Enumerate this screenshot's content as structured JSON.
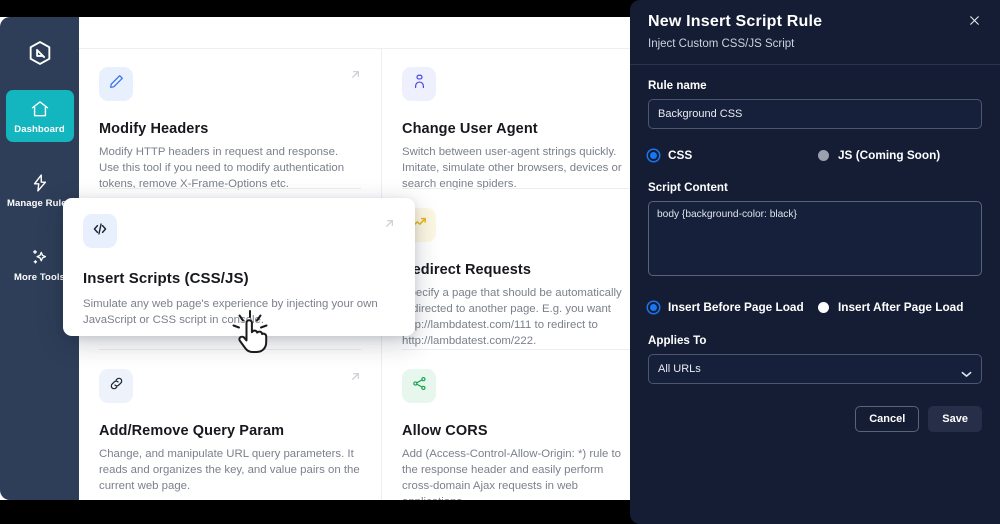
{
  "sidebar": {
    "logo_icon": "cube-logo-icon",
    "items": [
      {
        "label": "Dashboard",
        "icon": "home-icon",
        "active": true
      },
      {
        "label": "Manage Rules",
        "icon": "bolt-icon",
        "active": false
      },
      {
        "label": "More Tools",
        "icon": "sparkles-icon",
        "active": false
      }
    ]
  },
  "cards": [
    {
      "title": "Modify Headers",
      "desc": "Modify HTTP headers in request and response. Use this tool if you need to modify authentication tokens, remove X-Frame-Options etc.",
      "icon": "pencil-icon",
      "icon_color": "#2f6df0",
      "icon_bg": "#e8f0fe"
    },
    {
      "title": "Change User Agent",
      "desc": "Switch between user-agent strings quickly. Imitate, simulate other browsers, devices or search engine spiders.",
      "icon": "users-icon",
      "icon_color": "#4f46e5",
      "icon_bg": "#eef0fe"
    },
    {
      "title": "Redirect Requests",
      "desc": "Specify a page that should be automatically redirected to another page. E.g. you want http://lambdatest.com/111 to redirect to http://lambdatest.com/222.",
      "icon": "redirect-arrow-icon",
      "icon_color": "#eab308",
      "icon_bg": "#fdf8e3"
    },
    {
      "title": "Add/Remove Query Param",
      "desc": "Change, and manipulate URL query parameters. It reads and organizes the key, and value pairs on the current web page.",
      "icon": "link-icon",
      "icon_color": "#1b2430",
      "icon_bg": "#edf2fb"
    },
    {
      "title": "Allow CORS",
      "desc": "Add (Access-Control-Allow-Origin: *) rule to the response header and easily perform cross-domain Ajax requests in web applications.",
      "icon": "share-nodes-icon",
      "icon_color": "#16a34a",
      "icon_bg": "#e7f7ed"
    }
  ],
  "hover_card": {
    "title": "Insert Scripts (CSS/JS)",
    "desc": "Simulate any web page's experience by injecting your own JavaScript or CSS script in console.",
    "icon": "code-brackets-icon",
    "icon_color": "#1b2430",
    "icon_bg": "#e8f0fe"
  },
  "panel": {
    "title": "New Insert Script Rule",
    "subtitle": "Inject Custom CSS/JS Script",
    "close_icon": "close-icon",
    "rule_name": {
      "label": "Rule name",
      "value": "Background CSS"
    },
    "script_type": {
      "options": [
        {
          "label": "CSS",
          "selected": true,
          "state": "selected"
        },
        {
          "label": "JS (Coming Soon)",
          "selected": false,
          "state": "disabled"
        }
      ]
    },
    "script_content": {
      "label": "Script Content",
      "value": "body {background-color: black}"
    },
    "insert_timing": {
      "options": [
        {
          "label": "Insert Before Page Load",
          "selected": true
        },
        {
          "label": "Insert After Page Load",
          "selected": false
        }
      ]
    },
    "applies_to": {
      "label": "Applies To",
      "value": "All URLs",
      "caret_icon": "chevron-down-icon"
    },
    "buttons": {
      "cancel": "Cancel",
      "save": "Save"
    }
  },
  "colors": {
    "sidebar_bg": "#2e3e58",
    "active_nav": "#13b6bf",
    "panel_bg": "#141d33",
    "accent_blue": "#1976f0"
  }
}
